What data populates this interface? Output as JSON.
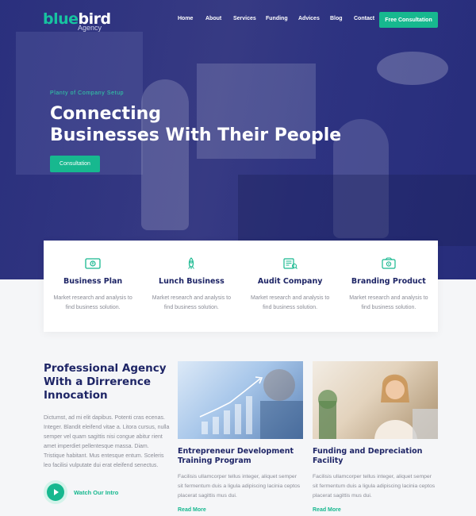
{
  "brand": {
    "name_part1": "blue",
    "name_part2": "bird",
    "sub": "Agency"
  },
  "nav": {
    "items": [
      "Home",
      "About",
      "Services",
      "Funding",
      "Advices",
      "Blog",
      "Contact"
    ],
    "cta": "Free Consultation"
  },
  "hero": {
    "eyebrow": "Planty of Company Setup",
    "title_line1": "Connecting",
    "title_line2": "Businesses With Their People",
    "button": "Consultation"
  },
  "services": [
    {
      "icon": "business-plan-icon",
      "title": "Business Plan",
      "desc": "Market research and analysis to find business solution."
    },
    {
      "icon": "rocket-icon",
      "title": "Lunch Business",
      "desc": "Market research and analysis to find business solution."
    },
    {
      "icon": "audit-icon",
      "title": "Audit Company",
      "desc": "Market research and analysis to find business solution."
    },
    {
      "icon": "branding-icon",
      "title": "Branding Product",
      "desc": "Market research and analysis to find business solution."
    }
  ],
  "intro": {
    "title": "Professional Agency With a Dirrerence Innocation",
    "text": "Dictumst, ad mi elit dapibus. Potenti cras ecenas. Integer. Blandit eleifend vitae a. Litora cursus, nulla semper vel quam sagittis nisi congue abitur rient amet imperdiet pellentesque massa. Diam. Tristique habitant. Mus entesque entum. Sceleris leo facilisi vulputate dui erat eleifend senectus.",
    "watch": "Watch Our Intro"
  },
  "cards": [
    {
      "title": "Entrepreneur Development Training Program",
      "text": "Facilisis ullamcorper tellus integer, aliquet semper sit fermentum duis a ligula adipiscing lacinia ceptos placerat sagittis mus dui.",
      "more": "Read More"
    },
    {
      "title": "Funding and Depreciation Facility",
      "text": "Facilisis ullamcorper tellus integer, aliquet semper sit fermentum duis a ligula adipiscing lacinia ceptos placerat sagittis mus dui.",
      "more": "Read More"
    }
  ],
  "colors": {
    "primary": "#1e2566",
    "accent": "#17b88f",
    "hero_overlay": "#262c82"
  }
}
